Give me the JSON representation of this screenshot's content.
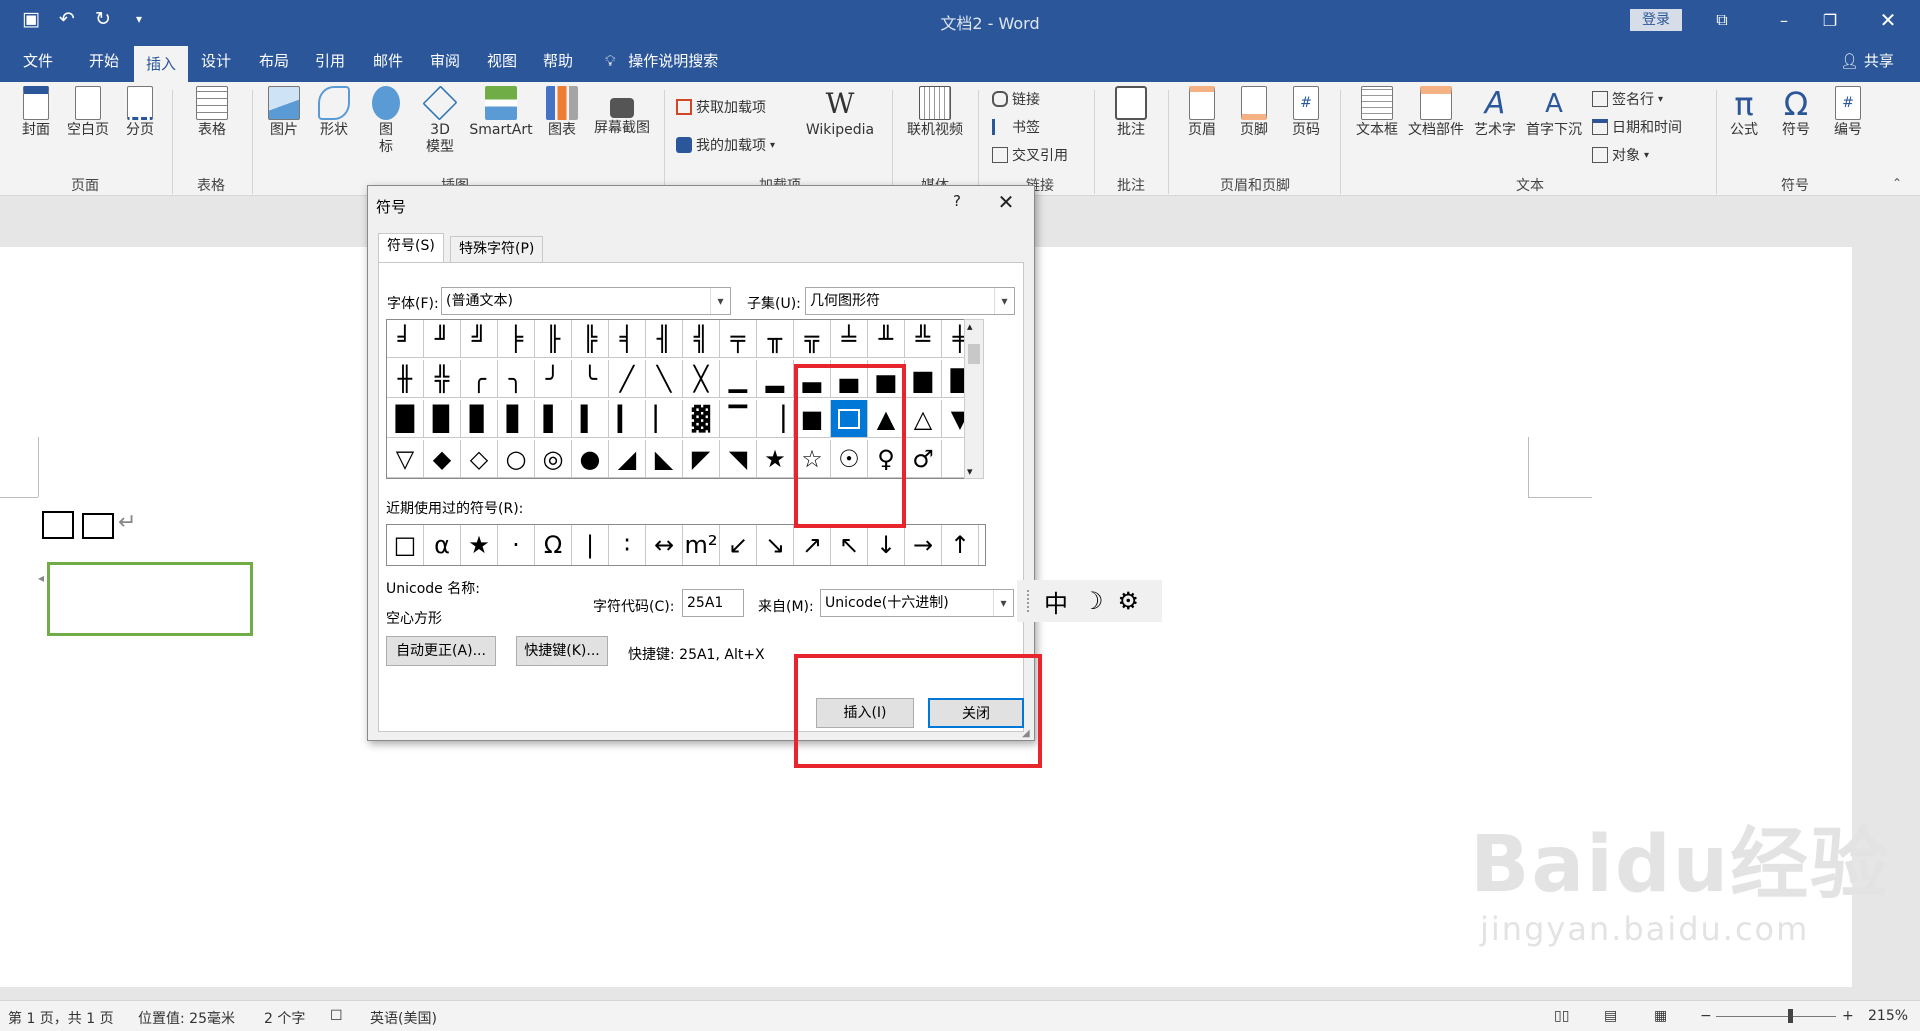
{
  "window": {
    "title": "文档2  -  Word",
    "login_label": "登录"
  },
  "tabs": [
    "文件",
    "开始",
    "插入",
    "设计",
    "布局",
    "引用",
    "邮件",
    "审阅",
    "视图",
    "帮助"
  ],
  "active_tab": "插入",
  "tell_me": "操作说明搜索",
  "share_label": "共享",
  "ribbon": {
    "pages": {
      "cover": "封面",
      "blank": "空白页",
      "break": "分页",
      "group": "页面"
    },
    "tables": {
      "table": "表格",
      "group": "表格"
    },
    "illustrations": {
      "picture": "图片",
      "shapes": "形状",
      "icons": "图\n标",
      "model3d": "3D\n模型",
      "smartart": "SmartArt",
      "chart": "图表",
      "screenshot": "屏幕截图",
      "group": "插图"
    },
    "addins": {
      "get": "获取加载项",
      "my": "我的加载项",
      "wiki": "Wikipedia",
      "group": "加载项"
    },
    "media": {
      "video": "联机视频",
      "group": "媒体"
    },
    "links": {
      "link": "链接",
      "bookmark": "书签",
      "crossref": "交叉引用",
      "group": "链接"
    },
    "comments": {
      "comment": "批注",
      "group": "批注"
    },
    "headerfooter": {
      "header": "页眉",
      "footer": "页脚",
      "pagenum": "页码",
      "group": "页眉和页脚"
    },
    "text": {
      "textbox": "文本框",
      "quickparts": "文档部件",
      "wordart": "艺术字",
      "dropcap": "首字下沉",
      "signature": "签名行",
      "datetime": "日期和时间",
      "object": "对象",
      "group": "文本"
    },
    "symbols": {
      "equation": "公式",
      "symbol": "符号",
      "number": "编号",
      "group": "符号"
    }
  },
  "dialog": {
    "title": "符号",
    "help": "?",
    "tab_symbols": "符号(S)",
    "tab_special": "特殊字符(P)",
    "font_label": "字体(F):",
    "font_value": "(普通文本)",
    "subset_label": "子集(U):",
    "subset_value": "几何图形符",
    "grid_rows": [
      [
        "╛",
        "╜",
        "╝",
        "╞",
        "╟",
        "╠",
        "╡",
        "╢",
        "╣",
        "╤",
        "╥",
        "╦",
        "╧",
        "╨",
        "╩",
        "╪"
      ],
      [
        "╫",
        "╬",
        "╭",
        "╮",
        "╯",
        "╰",
        "╱",
        "╲",
        "╳",
        "▁",
        "▂",
        "▃",
        "▄",
        "▅",
        "▆",
        "▇"
      ],
      [
        "█",
        "▉",
        "▊",
        "▋",
        "▌",
        "▍",
        "▎",
        "▏",
        "▓",
        "▔",
        "▕",
        "■",
        "□",
        "▲",
        "△",
        "▼"
      ],
      [
        "▽",
        "◆",
        "◇",
        "○",
        "◎",
        "●",
        "◢",
        "◣",
        "◤",
        "◥",
        "★",
        "☆",
        "☉",
        "♀",
        "♂",
        ""
      ]
    ],
    "selected": "□",
    "recent_label": "近期使用过的符号(R):",
    "recent": [
      "□",
      "α",
      "★",
      "·",
      "Ω",
      "|",
      "∶",
      "↔",
      "m²",
      "↙",
      "↘",
      "↗",
      "↖",
      "↓",
      "→",
      "↑"
    ],
    "unicode_name_label": "Unicode 名称:",
    "unicode_name": "空心方形",
    "char_code_label": "字符代码(C):",
    "char_code": "25A1",
    "from_label": "来自(M):",
    "from_value": "Unicode(十六进制)",
    "autocorrect_label": "自动更正(A)...",
    "shortcut_btn_label": "快捷键(K)...",
    "shortcut_text": "快捷键: 25A1, Alt+X",
    "insert_label": "插入(I)",
    "close_label": "关闭"
  },
  "ime": {
    "mode": "中",
    "moon": "☽",
    "gear": "⚙"
  },
  "statusbar": {
    "page": "第 1 页，共 1 页",
    "position": "位置值: 25毫米",
    "words": "2 个字",
    "language": "英语(美国)",
    "zoom": "215%"
  },
  "watermark": {
    "main": "Baidu经验",
    "sub": "jingyan.baidu.com"
  },
  "colors": {
    "accent": "#2b579a",
    "selection": "#0078d7",
    "highlight": "#e8242d",
    "textbox_border": "#70ad47"
  }
}
